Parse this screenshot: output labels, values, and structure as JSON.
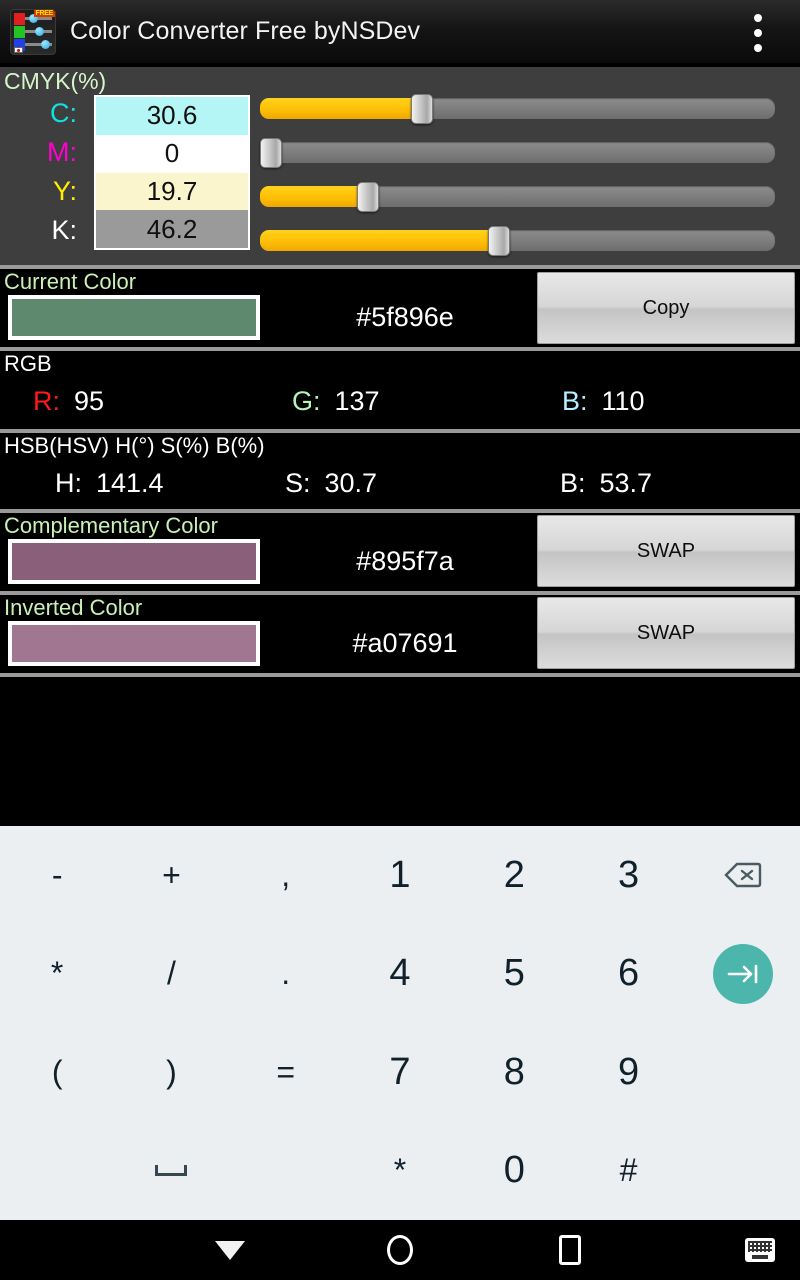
{
  "titlebar": {
    "app_name": "Color Converter Free byNSDev",
    "icon": "app-logo-icon",
    "overflow": "overflow-menu-icon"
  },
  "cmyk": {
    "title": "CMYK(%)",
    "rows": [
      {
        "label": "C:",
        "value": "30.6",
        "slider_pct": 30.6
      },
      {
        "label": "M:",
        "value": "0",
        "slider_pct": 0
      },
      {
        "label": "Y:",
        "value": "19.7",
        "slider_pct": 19.7
      },
      {
        "label": "K:",
        "value": "46.2",
        "slider_pct": 46.2
      }
    ],
    "focused_row": "K"
  },
  "current_color": {
    "title": "Current Color",
    "hex": "#5f896e",
    "swatch_color": "#5f896e",
    "button_label": "Copy"
  },
  "rgb": {
    "title": "RGB",
    "items": [
      {
        "key": "R:",
        "value": "95"
      },
      {
        "key": "G:",
        "value": "137"
      },
      {
        "key": "B:",
        "value": "110"
      }
    ]
  },
  "hsb": {
    "title": "HSB(HSV) H(°) S(%) B(%)",
    "items": [
      {
        "key": "H:",
        "value": "141.4"
      },
      {
        "key": "S:",
        "value": "30.7"
      },
      {
        "key": "B:",
        "value": "53.7"
      }
    ]
  },
  "complementary_color": {
    "title": "Complementary Color",
    "hex": "#895f7a",
    "swatch_color": "#895f7a",
    "button_label": "SWAP"
  },
  "inverted_color": {
    "title": "Inverted Color",
    "hex": "#a07691",
    "swatch_color": "#a07691",
    "button_label": "SWAP"
  },
  "keyboard": {
    "keys": [
      {
        "label": "-",
        "type": "sym"
      },
      {
        "label": "+",
        "type": "sym"
      },
      {
        "label": ",",
        "type": "sym"
      },
      {
        "label": "1",
        "type": "num"
      },
      {
        "label": "2",
        "type": "num"
      },
      {
        "label": "3",
        "type": "num"
      },
      {
        "label": "",
        "type": "backspace"
      },
      {
        "label": "*",
        "type": "sym"
      },
      {
        "label": "/",
        "type": "sym"
      },
      {
        "label": ".",
        "type": "sym"
      },
      {
        "label": "4",
        "type": "num"
      },
      {
        "label": "5",
        "type": "num"
      },
      {
        "label": "6",
        "type": "num"
      },
      {
        "label": "",
        "type": "enter"
      },
      {
        "label": "(",
        "type": "sym"
      },
      {
        "label": ")",
        "type": "sym"
      },
      {
        "label": "=",
        "type": "sym"
      },
      {
        "label": "7",
        "type": "num"
      },
      {
        "label": "8",
        "type": "num"
      },
      {
        "label": "9",
        "type": "num"
      },
      {
        "label": "",
        "type": "blank"
      },
      {
        "label": "",
        "type": "blank"
      },
      {
        "label": "",
        "type": "space"
      },
      {
        "label": "",
        "type": "blank"
      },
      {
        "label": "*",
        "type": "sym"
      },
      {
        "label": "0",
        "type": "num"
      },
      {
        "label": "#",
        "type": "sym"
      },
      {
        "label": "",
        "type": "blank"
      }
    ]
  },
  "navbar": {
    "back": "back-nav-icon",
    "home": "home-nav-icon",
    "recents": "recents-nav-icon",
    "keyboard_switch": "keyboard-switch-icon"
  },
  "colors": {
    "accent_yellow": "#ffc107",
    "panel_gray": "#3e3e3e",
    "label_green": "#c9f0b6",
    "enter_teal": "#4db6ac",
    "keyboard_bg": "#eceff1"
  }
}
